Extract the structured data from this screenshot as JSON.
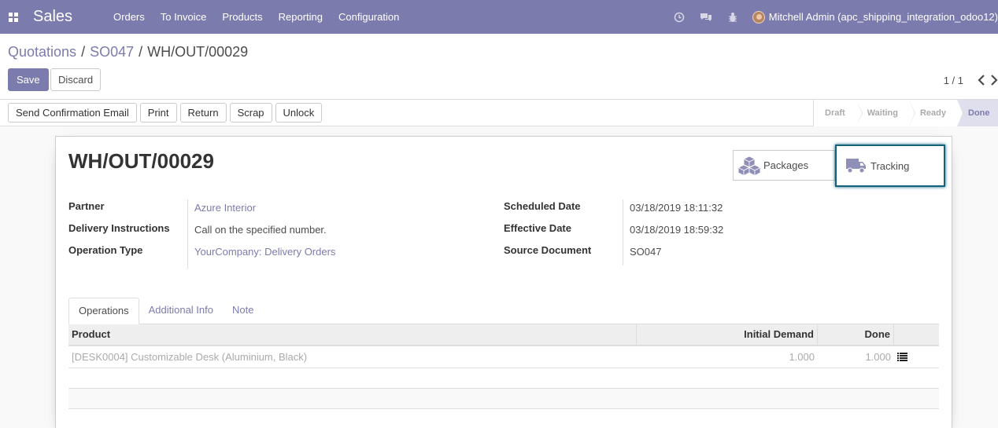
{
  "navbar": {
    "brand": "Sales",
    "menu": [
      "Orders",
      "To Invoice",
      "Products",
      "Reporting",
      "Configuration"
    ],
    "icons": [
      "clock-icon",
      "chat-icon",
      "bug-icon"
    ],
    "user": "Mitchell Admin (apc_shipping_integration_odoo12)",
    "bg_color": "#7c7bad"
  },
  "breadcrumb": {
    "items": [
      "Quotations",
      "SO047"
    ],
    "separator": "/",
    "current": "WH/OUT/00029"
  },
  "buttons": {
    "save": "Save",
    "discard": "Discard"
  },
  "pager": {
    "value": "1 / 1"
  },
  "header_buttons": [
    "Send Confirmation Email",
    "Print",
    "Return",
    "Scrap",
    "Unlock"
  ],
  "stages": [
    "Draft",
    "Waiting",
    "Ready",
    "Done"
  ],
  "active_stage": "Done",
  "record": {
    "title": "WH/OUT/00029"
  },
  "smart_buttons": {
    "packages": "Packages",
    "tracking": "Tracking"
  },
  "left_group": [
    {
      "label": "Partner",
      "value": "Azure Interior",
      "link": true
    },
    {
      "label": "Delivery Instructions",
      "value": "Call on the specified number.",
      "link": false
    },
    {
      "label": "Operation Type",
      "value": "YourCompany: Delivery Orders",
      "link": true
    }
  ],
  "right_group": [
    {
      "label": "Scheduled Date",
      "value": "03/18/2019 18:11:32"
    },
    {
      "label": "Effective Date",
      "value": "03/18/2019 18:59:32"
    },
    {
      "label": "Source Document",
      "value": "SO047"
    }
  ],
  "tabs": [
    "Operations",
    "Additional Info",
    "Note"
  ],
  "table": {
    "columns": [
      "Product",
      "Initial Demand",
      "Done"
    ],
    "rows": [
      {
        "product": "[DESK0004] Customizable Desk (Aluminium, Black)",
        "initial_demand": "1.000",
        "done": "1.000"
      }
    ]
  }
}
